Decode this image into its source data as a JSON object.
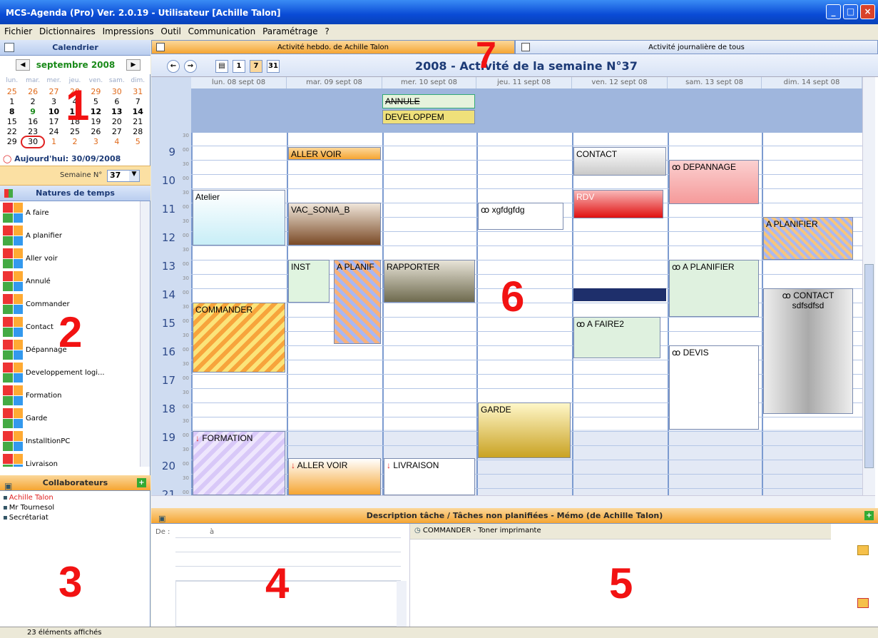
{
  "window": {
    "title": "MCS-Agenda (Pro) Ver. 2.0.19 - Utilisateur [Achille Talon]"
  },
  "menu": [
    "Fichier",
    "Dictionnaires",
    "Impressions",
    "Outil",
    "Communication",
    "Paramétrage",
    "?"
  ],
  "sidebar": {
    "calendar_header": "Calendrier",
    "month": "septembre 2008",
    "weekday_headers": [
      "lun.",
      "mar.",
      "mer.",
      "jeu.",
      "ven.",
      "sam.",
      "dim."
    ],
    "weeks": [
      [
        "25",
        "26",
        "27",
        "28",
        "29",
        "30",
        "31"
      ],
      [
        "1",
        "2",
        "3",
        "4",
        "5",
        "6",
        "7"
      ],
      [
        "8",
        "9",
        "10",
        "11",
        "12",
        "13",
        "14"
      ],
      [
        "15",
        "16",
        "17",
        "18",
        "19",
        "20",
        "21"
      ],
      [
        "22",
        "23",
        "24",
        "25",
        "26",
        "27",
        "28"
      ],
      [
        "29",
        "30",
        "1",
        "2",
        "3",
        "4",
        "5"
      ]
    ],
    "today_label": "Aujourd'hui: 30/09/2008",
    "week_label": "Semaine N°",
    "week_value": "37",
    "natures_header": "Natures de temps",
    "natures": [
      "A faire",
      "A planifier",
      "Aller voir",
      "Annulé",
      "Commander",
      "Contact",
      "Dépannage",
      "Developpement logi...",
      "Formation",
      "Garde",
      "InstalltionPC",
      "Livraison"
    ],
    "collab_header": "Collaborateurs",
    "collaborators": [
      "Achille Talon",
      "Mr Tournesol",
      "Secrétariat"
    ]
  },
  "status": {
    "text": "23 éléments affichés"
  },
  "tabs": [
    "Activité hebdo. de Achille Talon",
    "Activité journalière de tous"
  ],
  "week_title": "2008 - Activité de la semaine N°37",
  "toolbar_icons": [
    "back-icon",
    "forward-icon",
    "print-icon",
    "day-view-icon",
    "week-view-icon",
    "month-view-icon"
  ],
  "toolbar_labels": {
    "day": "1",
    "week": "7",
    "month": "31"
  },
  "days": [
    "lun. 08 sept 08",
    "mar. 09 sept 08",
    "mer. 10 sept 08",
    "jeu. 11 sept 08",
    "ven. 12 sept 08",
    "sam. 13 sept 08",
    "dim. 14 sept 08"
  ],
  "hours": [
    "9",
    "10",
    "11",
    "12",
    "13",
    "14",
    "15",
    "16",
    "17",
    "18",
    "19",
    "20",
    "21"
  ],
  "minute_labels": {
    "top": "00",
    "half": "30"
  },
  "allday_events": [
    "ANNULE",
    "DEVELOPPEM"
  ],
  "events": {
    "atelier": "Atelier",
    "commander": "COMMANDER",
    "formation": "FORMATION",
    "aller_voir_1": "ALLER VOIR",
    "vac_sonia": "VAC_SONIA_B",
    "inst": "INST",
    "a_planif": "A PLANIF",
    "aller_voir_2": "ALLER VOIR",
    "rapporter": "RAPPORTER",
    "livraison": "LIVRAISON",
    "xgfdgfdg": "xgfdgfdg",
    "garde": "GARDE",
    "contact": "CONTACT",
    "rdv": "RDV",
    "a_faire2": "A FAIRE2",
    "depannage": "DEPANNAGE",
    "a_planifier_sat": "A PLANIFIER",
    "devis": "DEVIS",
    "a_planifier_sun": "A PLANIFIER",
    "contact_sun": "CONTACT",
    "contact_sun_sub": "sdfsdfsd"
  },
  "bottom": {
    "header": "Description tâche  /  Tâches non planifiées - Mémo (de Achille Talon)",
    "from_label": "De :",
    "to_label": "à",
    "task": "COMMANDER - Toner imprimante"
  },
  "annotations": [
    "1",
    "2",
    "3",
    "4",
    "5",
    "6",
    "7"
  ],
  "colors": {
    "accent": "#f5a532",
    "title_blue": "#1c3a76",
    "annotation_red": "#f21212"
  }
}
